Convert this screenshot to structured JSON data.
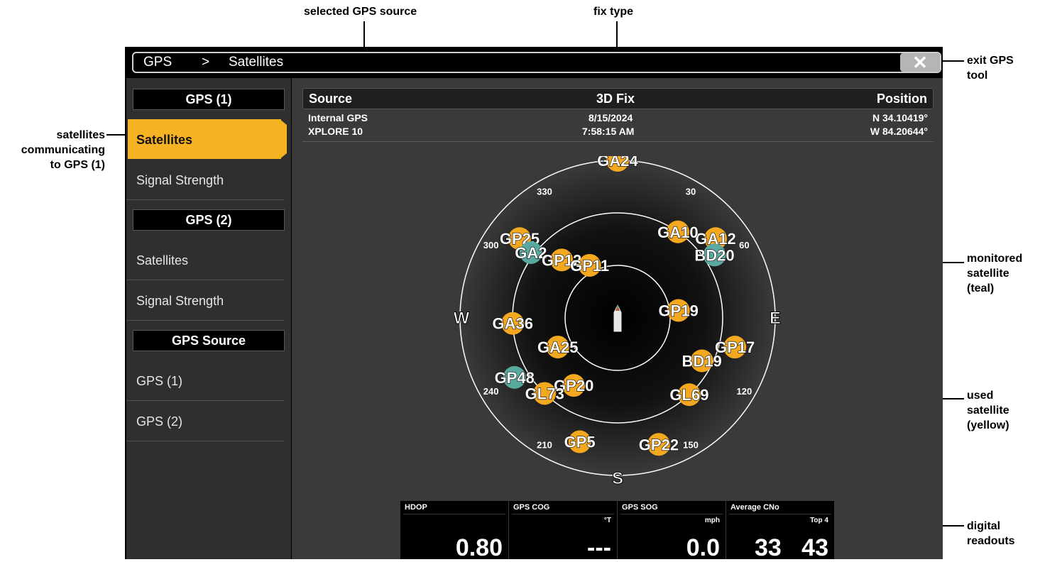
{
  "callouts": {
    "selected_source": "selected GPS source",
    "fix_type": "fix type",
    "exit_line1": "exit GPS",
    "exit_line2": "tool",
    "satcomm_line1": "satellites",
    "satcomm_line2": "communicating",
    "satcomm_line3": "to GPS (1)",
    "monitored_line1": "monitored",
    "monitored_line2": "satellite",
    "monitored_line3": "(teal)",
    "used_line1": "used",
    "used_line2": "satellite",
    "used_line3": "(yellow)",
    "readouts_line1": "digital",
    "readouts_line2": "readouts"
  },
  "breadcrumb": {
    "root": "GPS",
    "separator": ">",
    "current": "Satellites"
  },
  "close_icon": "✕",
  "sidebar": {
    "gps1_header": "GPS (1)",
    "gps1_items": [
      "Satellites",
      "Signal Strength"
    ],
    "gps2_header": "GPS (2)",
    "gps2_items": [
      "Satellites",
      "Signal Strength"
    ],
    "source_header": "GPS Source",
    "source_items": [
      "GPS (1)",
      "GPS (2)"
    ]
  },
  "infobar": {
    "source": "Source",
    "fix": "3D Fix",
    "position": "Position"
  },
  "info": {
    "source_line1": "Internal GPS",
    "source_line2": "XPLORE 10",
    "date": "8/15/2024",
    "time": "7:58:15 AM",
    "lat": "N 34.10419°",
    "lon": "W 84.20644°"
  },
  "skyplot": {
    "bearings": [
      "30",
      "60",
      "120",
      "150",
      "210",
      "240",
      "300",
      "330"
    ],
    "cardinals": {
      "W": "W",
      "E": "E",
      "S": "S"
    },
    "satellites": [
      {
        "id": "GA24",
        "az": 0,
        "elev": 0,
        "state": "used"
      },
      {
        "id": "GP25",
        "az": 309,
        "elev": 18,
        "state": "used"
      },
      {
        "id": "GA2",
        "az": 307,
        "elev": 28,
        "state": "monitored"
      },
      {
        "id": "GA12",
        "az": 51,
        "elev": 18,
        "state": "used"
      },
      {
        "id": "BD20",
        "az": 57,
        "elev": 24,
        "state": "monitored"
      },
      {
        "id": "GA10",
        "az": 35,
        "elev": 30,
        "state": "used"
      },
      {
        "id": "GP12",
        "az": 316,
        "elev": 44,
        "state": "used"
      },
      {
        "id": "GP11",
        "az": 332,
        "elev": 56,
        "state": "used"
      },
      {
        "id": "GP19",
        "az": 83,
        "elev": 55,
        "state": "used"
      },
      {
        "id": "GA36",
        "az": 267,
        "elev": 30,
        "state": "used"
      },
      {
        "id": "GA25",
        "az": 244,
        "elev": 52,
        "state": "used"
      },
      {
        "id": "GP17",
        "az": 104,
        "elev": 21,
        "state": "used"
      },
      {
        "id": "BD19",
        "az": 117,
        "elev": 36,
        "state": "used"
      },
      {
        "id": "GP48",
        "az": 240,
        "elev": 22,
        "state": "monitored"
      },
      {
        "id": "GP20",
        "az": 213,
        "elev": 44,
        "state": "used"
      },
      {
        "id": "GL73",
        "az": 224,
        "elev": 30,
        "state": "used"
      },
      {
        "id": "GL69",
        "az": 137,
        "elev": 30,
        "state": "used"
      },
      {
        "id": "GP5",
        "az": 197,
        "elev": 16,
        "state": "used"
      },
      {
        "id": "GP22",
        "az": 162,
        "elev": 14,
        "state": "used"
      }
    ]
  },
  "readouts": [
    {
      "label": "HDOP",
      "unit": "",
      "value": "0.80"
    },
    {
      "label": "GPS COG",
      "unit": "°T",
      "value": "---"
    },
    {
      "label": "GPS SOG",
      "unit": "mph",
      "value": "0.0"
    },
    {
      "label": "Average CNo",
      "unit": "Top 4",
      "value": "33   43"
    }
  ],
  "colors": {
    "used": "#f4a820",
    "monitored": "#5aa9a1",
    "selected": "#f5b324"
  }
}
